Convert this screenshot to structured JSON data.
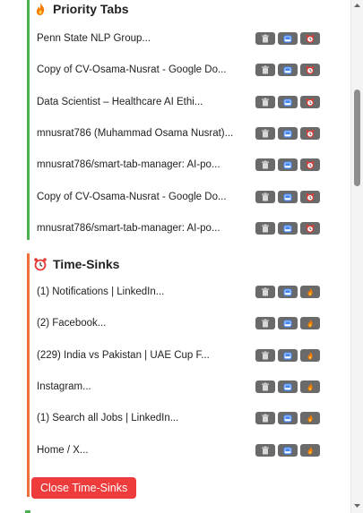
{
  "priority": {
    "title": "Priority Tabs",
    "header_icon": "fire-icon",
    "accent": "#4caf50",
    "tabs": [
      "Penn State NLP Group...",
      "Copy of CV-Osama-Nusrat - Google Do...",
      "Data Scientist – Healthcare AI Ethi...",
      "mnusrat786 (Muhammad Osama Nusrat)...",
      "mnusrat786/smart-tab-manager: AI-po...",
      "Copy of CV-Osama-Nusrat - Google Do...",
      "mnusrat786/smart-tab-manager: AI-po..."
    ],
    "row_buttons": [
      "trash-icon",
      "bookmark-icon",
      "alarm-clock-icon"
    ]
  },
  "sinks": {
    "title": "Time-Sinks",
    "header_icon": "alarm-clock-icon",
    "accent": "#f0703a",
    "tabs": [
      "(1) Notifications | LinkedIn...",
      "(2) Facebook...",
      "(229) India vs Pakistan | UAE Cup F...",
      "Instagram...",
      "(1) Search all Jobs | LinkedIn...",
      "Home / X..."
    ],
    "row_buttons": [
      "trash-icon",
      "bookmark-icon",
      "fire-icon"
    ],
    "close_label": "Close Time-Sinks",
    "close_color": "#ee3b3b"
  }
}
